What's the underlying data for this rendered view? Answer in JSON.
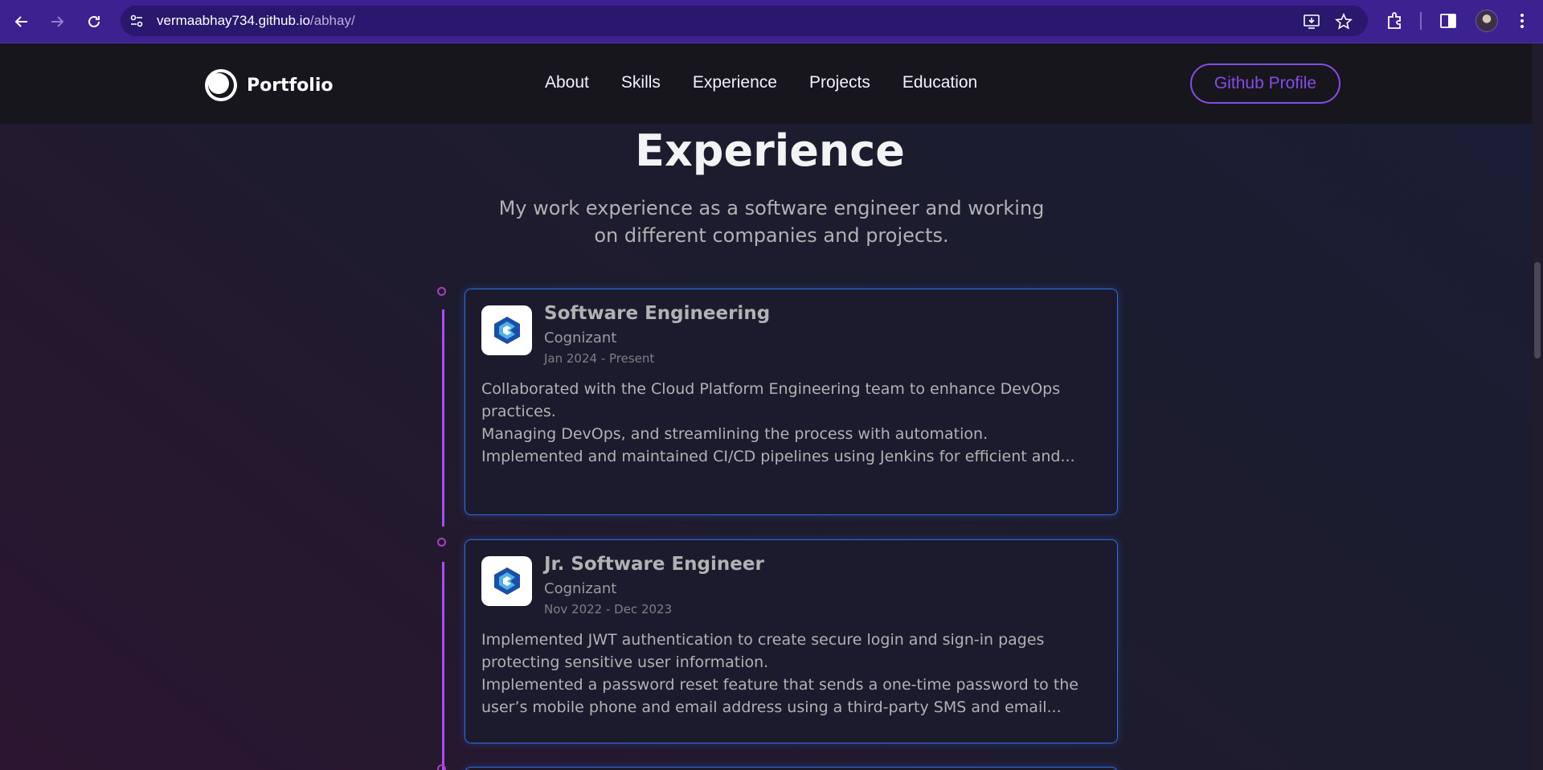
{
  "browser": {
    "url_host": "vermaabhay734.github.io",
    "url_path": "/abhay/",
    "icons": [
      "back-icon",
      "forward-icon",
      "reload-icon",
      "site-info-icon",
      "install-app-icon",
      "bookmark-star-icon",
      "extensions-icon",
      "side-panel-icon",
      "profile-avatar",
      "menu-dots-icon"
    ]
  },
  "site": {
    "logo_text": "Portfolio",
    "nav": [
      "About",
      "Skills",
      "Experience",
      "Projects",
      "Education"
    ],
    "github_button": "Github Profile",
    "accent": "#854ce6"
  },
  "section": {
    "title": "Experience",
    "description": "My work experience as a software engineer and working on different companies and projects."
  },
  "experiences": [
    {
      "role": "Software Engineering",
      "company": "Cognizant",
      "date": "Jan 2024 - Present",
      "lines": [
        "Collaborated with the Cloud Platform Engineering team to enhance DevOps",
        "practices.",
        "Managing DevOps, and streamlining the process with automation.",
        "Implemented and maintained CI/CD pipelines using Jenkins for efficient and..."
      ]
    },
    {
      "role": "Jr. Software Engineer",
      "company": "Cognizant",
      "date": "Nov 2022 - Dec 2023",
      "lines": [
        "Implemented JWT authentication to create secure login and sign-in pages",
        "protecting sensitive user information.",
        "Implemented a password reset feature that sends a one-time password to the",
        "user’s mobile phone and email address using a third-party SMS and email..."
      ]
    }
  ]
}
